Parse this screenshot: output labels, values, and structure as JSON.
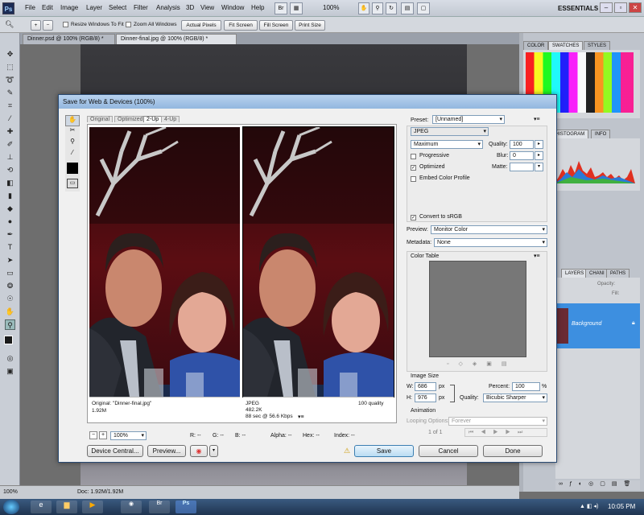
{
  "menubar": {
    "items": [
      "File",
      "Edit",
      "Image",
      "Layer",
      "Select",
      "Filter",
      "Analysis",
      "3D",
      "View",
      "Window",
      "Help"
    ],
    "zoom": "100%",
    "workspace": "ESSENTIALS"
  },
  "options": {
    "resize_windows": "Resize Windows To Fit",
    "zoom_all": "Zoom All Windows",
    "actual_pixels": "Actual Pixels",
    "fit_screen": "Fit Screen",
    "fill_screen": "Fill Screen",
    "print_size": "Print Size"
  },
  "doc_tabs": [
    "Dinner.psd @ 100% (RGB/8) *",
    "Dinner-final.jpg @ 100% (RGB/8) *"
  ],
  "panels": {
    "color_tabs": [
      "COLOR",
      "SWATCHES",
      "STYLES"
    ],
    "histogram_tabs": [
      "HISTOGRAM",
      "INFO"
    ],
    "layers_tabs": [
      "LAYERS",
      "CHANI",
      "PATHS"
    ],
    "opacity_label": "Opacity:",
    "fill_label": "Fill:",
    "layer_name": "Background"
  },
  "dialog": {
    "title": "Save for Web & Devices (100%)",
    "view_tabs": [
      "Original",
      "Optimized",
      "2-Up",
      "4-Up"
    ],
    "left_caption": {
      "line1": "Original: \"Dinner-final.jpg\"",
      "line2": "1.92M"
    },
    "right_caption": {
      "line1": "JPEG",
      "line2": "482.2K",
      "line3": "88 sec @ 56.6 Kbps",
      "quality": "100 quality"
    },
    "zoom": "100%",
    "pixel_info": {
      "r": "R: --",
      "g": "G: --",
      "b": "B: --",
      "alpha": "Alpha: --",
      "hex": "Hex: --",
      "index": "Index: --"
    },
    "preset_label": "Preset:",
    "preset_value": "[Unnamed]",
    "format": "JPEG",
    "compression": "Maximum",
    "quality_label": "Quality:",
    "quality_value": "100",
    "progressive": "Progressive",
    "blur_label": "Blur:",
    "blur_value": "0",
    "optimized": "Optimized",
    "matte_label": "Matte:",
    "embed_profile": "Embed Color Profile",
    "convert_srgb": "Convert to sRGB",
    "preview_label": "Preview:",
    "preview_value": "Monitor Color",
    "metadata_label": "Metadata:",
    "metadata_value": "None",
    "color_table": "Color Table",
    "image_size": "Image Size",
    "w_label": "W:",
    "w_value": "686",
    "h_label": "H:",
    "h_value": "976",
    "px": "px",
    "percent_label": "Percent:",
    "percent_value": "100",
    "pct": "%",
    "quality2_label": "Quality:",
    "quality2_value": "Bicubic Sharper",
    "animation": "Animation",
    "looping_label": "Looping Options:",
    "looping_value": "Forever",
    "frame": "1 of 1",
    "device_central": "Device Central...",
    "preview_btn": "Preview...",
    "save": "Save",
    "cancel": "Cancel",
    "done": "Done"
  },
  "status": {
    "zoom": "100%",
    "doc": "Doc: 1.92M/1.92M"
  },
  "taskbar": {
    "time": "10:05 PM"
  }
}
